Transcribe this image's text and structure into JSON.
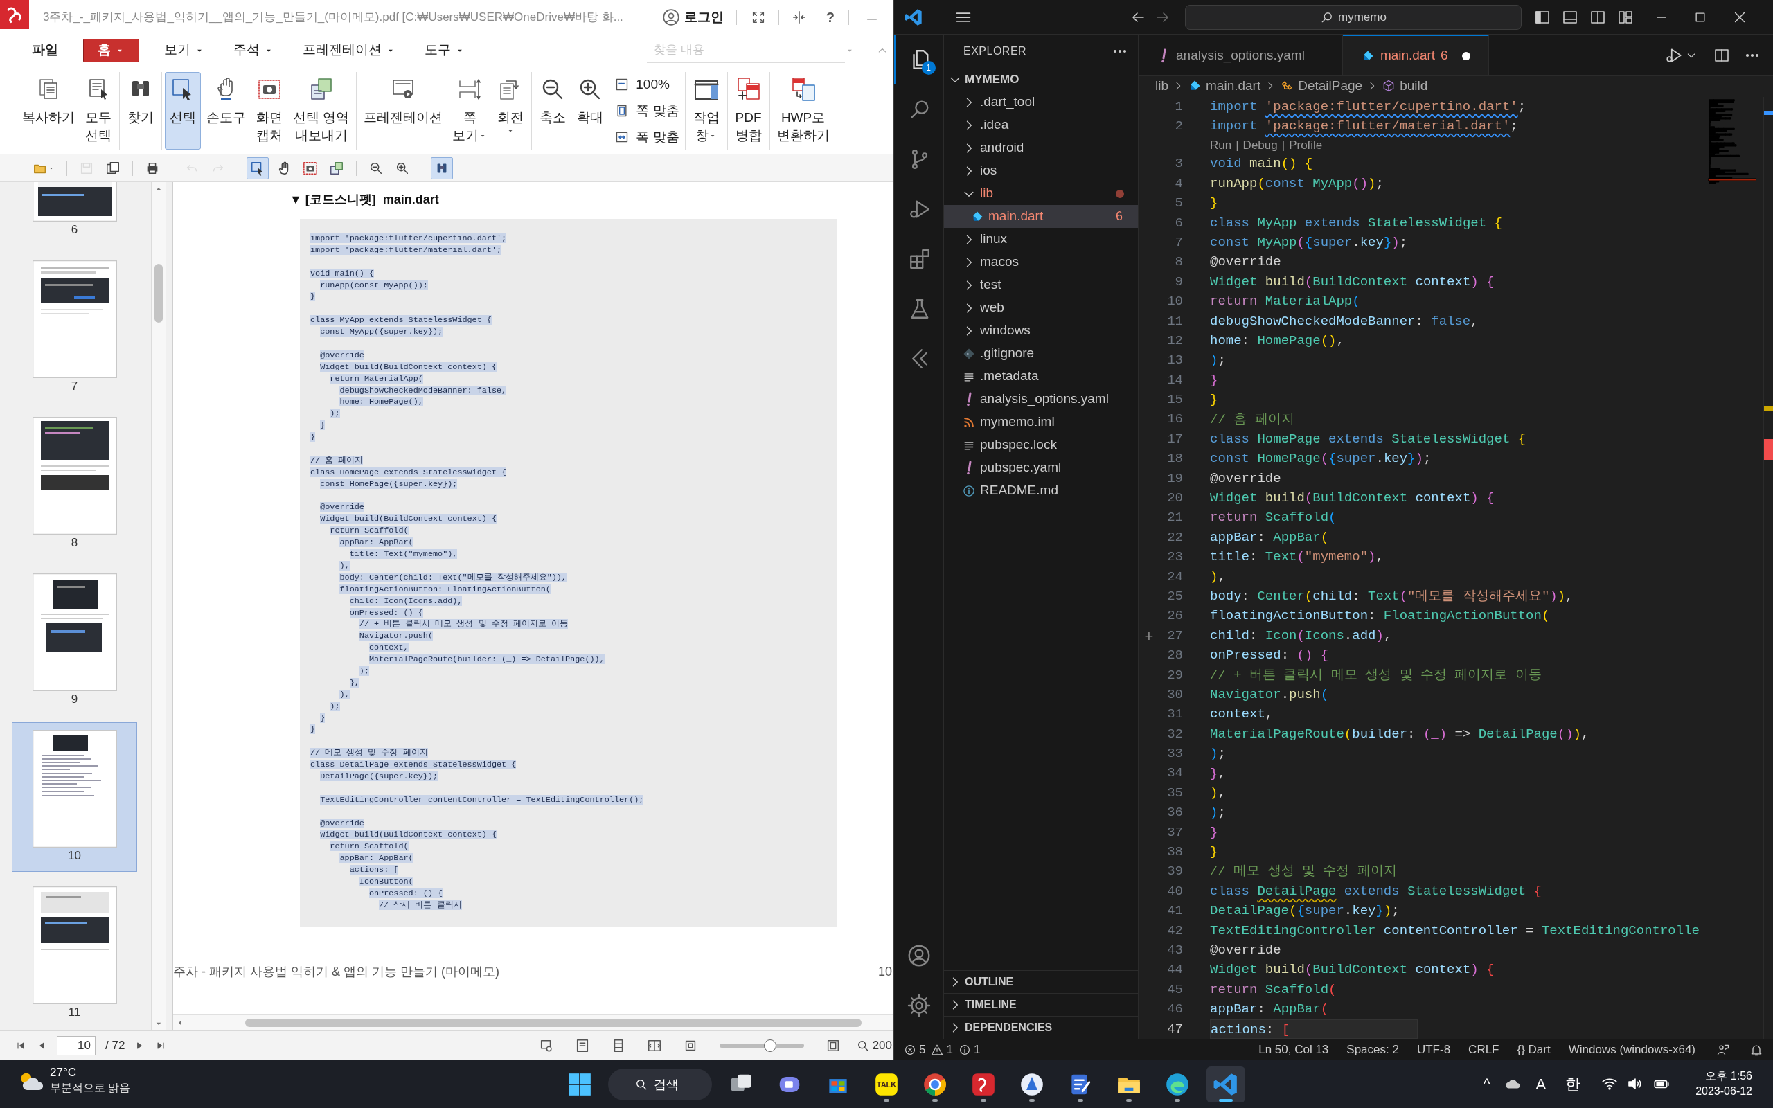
{
  "pdf_viewer": {
    "title": "3주차_-_패키지_사용법_익히기__앱의_기능_만들기_(마이메모).pdf [C:₩Users₩USER₩OneDrive₩바탕 화...",
    "login": "로그인",
    "help": "?",
    "menu": [
      {
        "label": "파일",
        "selected": false,
        "dropdown": false
      },
      {
        "label": "홈",
        "selected": true,
        "dropdown": true
      },
      {
        "label": "보기",
        "selected": false,
        "dropdown": true
      },
      {
        "label": "주석",
        "selected": false,
        "dropdown": true
      },
      {
        "label": "프레젠테이션",
        "selected": false,
        "dropdown": true
      },
      {
        "label": "도구",
        "selected": false,
        "dropdown": true
      }
    ],
    "search": {
      "placeholder": "찾을 내용"
    },
    "ribbon": [
      {
        "items": [
          {
            "label": "복사하기",
            "selected": false,
            "dropdown": false
          },
          {
            "label": "모두\n선택",
            "selected": false,
            "dropdown": false
          }
        ]
      },
      {
        "items": [
          {
            "label": "찾기",
            "selected": false,
            "dropdown": false
          }
        ]
      },
      {
        "items": [
          {
            "label": "선택",
            "selected": true,
            "dropdown": false
          },
          {
            "label": "손도구",
            "selected": false,
            "dropdown": false
          },
          {
            "label": "화면\n캡처",
            "selected": false,
            "dropdown": false
          },
          {
            "label": "선택 영역\n내보내기",
            "selected": false,
            "dropdown": false
          }
        ]
      },
      {
        "items": [
          {
            "label": "프레젠테이션",
            "selected": false,
            "dropdown": false
          },
          {
            "label": "쪽\n보기",
            "selected": false,
            "dropdown": true
          },
          {
            "label": "회전",
            "selected": false,
            "dropdown": true
          }
        ]
      },
      {
        "items": [
          {
            "label": "축소",
            "selected": false,
            "dropdown": false
          },
          {
            "label": "확대",
            "selected": false,
            "dropdown": false
          }
        ],
        "small": [
          "100%",
          "쪽 맞춤",
          "폭 맞춤"
        ]
      },
      {
        "items": [
          {
            "label": "작업\n창",
            "selected": false,
            "dropdown": true
          }
        ]
      },
      {
        "items": [
          {
            "label": "PDF\n병합",
            "selected": false,
            "dropdown": false
          }
        ]
      },
      {
        "items": [
          {
            "label": "HWP로\n변환하기",
            "selected": false,
            "dropdown": false
          }
        ]
      }
    ],
    "quick_toolbar": [
      {
        "selected": false,
        "disabled": false
      },
      {
        "selected": false,
        "disabled": true
      },
      {
        "selected": false,
        "disabled": false
      },
      {
        "selected": false,
        "disabled": false
      },
      {
        "selected": false,
        "disabled": true
      },
      {
        "selected": false,
        "disabled": true
      },
      {
        "selected": true,
        "disabled": false
      },
      {
        "selected": false,
        "disabled": false
      },
      {
        "selected": false,
        "disabled": false
      },
      {
        "selected": false,
        "disabled": false
      },
      {
        "selected": false,
        "disabled": false
      },
      {
        "selected": false,
        "disabled": false
      },
      {
        "selected": true,
        "disabled": false
      }
    ],
    "thumbnails": [
      {
        "page": "6",
        "selected": false
      },
      {
        "page": "7",
        "selected": false
      },
      {
        "page": "8",
        "selected": false
      },
      {
        "page": "9",
        "selected": false
      },
      {
        "page": "10",
        "selected": true
      },
      {
        "page": "11",
        "selected": false
      }
    ],
    "document": {
      "heading": "▼ [코드스니펫]  main.dart",
      "code_blocks": [
        [
          "import 'package:flutter/cupertino.dart';",
          "import 'package:flutter/material.dart';"
        ],
        [
          "void main() {",
          "  runApp(const MyApp());",
          "}"
        ],
        [
          "class MyApp extends StatelessWidget {",
          "  const MyApp({super.key});"
        ],
        [
          "  @override",
          "  Widget build(BuildContext context) {",
          "    return MaterialApp(",
          "      debugShowCheckedModeBanner: false,",
          "      home: HomePage(),",
          "    );",
          "  }",
          "}"
        ],
        [
          "// 홈 페이지",
          "class HomePage extends StatelessWidget {",
          "  const HomePage({super.key});"
        ],
        [
          "  @override",
          "  Widget build(BuildContext context) {",
          "    return Scaffold(",
          "      appBar: AppBar(",
          "        title: Text(\"mymemo\"),",
          "      ),",
          "      body: Center(child: Text(\"메모를 작성해주세요\")),",
          "      floatingActionButton: FloatingActionButton(",
          "        child: Icon(Icons.add),",
          "        onPressed: () {",
          "          // + 버튼 클릭시 메모 생성 및 수정 페이지로 이동",
          "          Navigator.push(",
          "            context,",
          "            MaterialPageRoute(builder: (_) => DetailPage()),",
          "          );",
          "        },",
          "      ),",
          "    );",
          "  }",
          "}"
        ],
        [
          "// 메모 생성 및 수정 페이지",
          "class DetailPage extends StatelessWidget {",
          "  DetailPage({super.key});"
        ],
        [
          "  TextEditingController contentController = TextEditingController();"
        ],
        [
          "  @override",
          "  Widget build(BuildContext context) {",
          "    return Scaffold(",
          "      appBar: AppBar(",
          "        actions: [",
          "          IconButton(",
          "            onPressed: () {",
          "              // 삭제 버튼 클릭시"
        ]
      ],
      "footer": "주차 - 패키지 사용법 익히기 & 앱의 기능 만들기 (마이메모)",
      "page_number": "10"
    },
    "status": {
      "page": "10",
      "total": "/ 72",
      "zoom_slider": {
        "level": 0.6
      },
      "zoom": "200"
    }
  },
  "vscode": {
    "command_center": "mymemo",
    "activity_bar": [
      {
        "selected": true,
        "badge": "1"
      },
      {
        "selected": false
      },
      {
        "selected": false
      },
      {
        "selected": false
      },
      {
        "selected": false
      },
      {
        "selected": false
      },
      {
        "selected": false
      }
    ],
    "explorer": {
      "title": "EXPLORER",
      "root": {
        "label": "MYMEMO",
        "expanded": true,
        "children": [
          {
            "label": ".dart_tool",
            "kind": "folder",
            "expanded": false,
            "selected": false,
            "error": false
          },
          {
            "label": ".idea",
            "kind": "folder",
            "expanded": false,
            "selected": false,
            "error": false
          },
          {
            "label": "android",
            "kind": "folder",
            "expanded": false,
            "selected": false,
            "error": false
          },
          {
            "label": "ios",
            "kind": "folder",
            "expanded": false,
            "selected": false,
            "error": false
          },
          {
            "label": "lib",
            "kind": "folder",
            "expanded": true,
            "selected": false,
            "error": true,
            "children": [
              {
                "label": "main.dart",
                "kind": "dart",
                "selected": true,
                "error": true,
                "problems": "6"
              }
            ]
          },
          {
            "label": "linux",
            "kind": "folder",
            "expanded": false,
            "selected": false,
            "error": false
          },
          {
            "label": "macos",
            "kind": "folder",
            "expanded": false,
            "selected": false,
            "error": false
          },
          {
            "label": "test",
            "kind": "folder",
            "expanded": false,
            "selected": false,
            "error": false
          },
          {
            "label": "web",
            "kind": "folder",
            "expanded": false,
            "selected": false,
            "error": false
          },
          {
            "label": "windows",
            "kind": "folder",
            "expanded": false,
            "selected": false,
            "error": false
          },
          {
            "label": ".gitignore",
            "kind": "git",
            "selected": false,
            "error": false
          },
          {
            "label": ".metadata",
            "kind": "text",
            "selected": false,
            "error": false
          },
          {
            "label": "analysis_options.yaml",
            "kind": "yaml",
            "selected": false,
            "error": false
          },
          {
            "label": "mymemo.iml",
            "kind": "feed",
            "selected": false,
            "error": false
          },
          {
            "label": "pubspec.lock",
            "kind": "text",
            "selected": false,
            "error": false
          },
          {
            "label": "pubspec.yaml",
            "kind": "yaml",
            "selected": false,
            "error": false
          },
          {
            "label": "README.md",
            "kind": "info",
            "selected": false,
            "error": false
          }
        ]
      }
    },
    "panels": [
      {
        "label": "OUTLINE",
        "expanded": false
      },
      {
        "label": "TIMELINE",
        "expanded": false
      },
      {
        "label": "DEPENDENCIES",
        "expanded": false
      }
    ],
    "tabs": [
      {
        "label": "analysis_options.yaml",
        "kind": "yaml",
        "selected": false,
        "error": false,
        "modified": false
      },
      {
        "label": "main.dart",
        "kind": "dart",
        "selected": true,
        "error": true,
        "problems": "6",
        "modified": true
      }
    ],
    "breadcrumb": [
      {
        "label": "lib",
        "kind": "folder"
      },
      {
        "label": "main.dart",
        "kind": "dart"
      },
      {
        "label": "DetailPage",
        "kind": "class"
      },
      {
        "label": "build",
        "kind": "method"
      }
    ],
    "lines": [
      {
        "kind": "code",
        "n": "1",
        "current": false,
        "code": [
          {
            "kind": "kw",
            "text": "import "
          },
          {
            "kind": "str_info",
            "text": "'package:flutter/cupertino.dart'"
          },
          {
            "kind": "txt",
            "text": ";"
          }
        ]
      },
      {
        "kind": "code",
        "n": "2",
        "current": false,
        "code": [
          {
            "kind": "kw",
            "text": "import "
          },
          {
            "kind": "str_info",
            "text": "'package:flutter/material.dart'"
          },
          {
            "kind": "txt",
            "text": ";"
          }
        ]
      },
      {
        "kind": "codelens",
        "links": [
          "Run",
          "Debug",
          "Profile"
        ],
        "separator": "|"
      },
      {
        "kind": "code",
        "n": "3",
        "current": false,
        "code": [
          {
            "kind": "kw",
            "text": "void "
          },
          {
            "kind": "fn",
            "text": "main"
          },
          {
            "kind": "br1",
            "text": "() {"
          }
        ]
      },
      {
        "kind": "code",
        "n": "4",
        "current": false,
        "code": [
          {
            "kind": "fn",
            "text": "runApp"
          },
          {
            "kind": "br1",
            "text": "("
          },
          {
            "kind": "kw",
            "text": "const "
          },
          {
            "kind": "type",
            "text": "MyApp"
          },
          {
            "kind": "br2",
            "text": "()"
          },
          {
            "kind": "br1",
            "text": ")"
          },
          {
            "kind": "txt",
            "text": ";"
          }
        ]
      },
      {
        "kind": "code",
        "n": "5",
        "current": false,
        "code": [
          {
            "kind": "br1",
            "text": "}"
          }
        ]
      },
      {
        "kind": "code",
        "n": "6",
        "current": false,
        "code": [
          {
            "kind": "kw",
            "text": "class "
          },
          {
            "kind": "type",
            "text": "MyApp "
          },
          {
            "kind": "kw",
            "text": "extends "
          },
          {
            "kind": "type",
            "text": "StatelessWidget "
          },
          {
            "kind": "br1",
            "text": "{"
          }
        ]
      },
      {
        "kind": "code",
        "n": "7",
        "current": false,
        "code": [
          {
            "kind": "kw",
            "text": "const "
          },
          {
            "kind": "type",
            "text": "MyApp"
          },
          {
            "kind": "br2",
            "text": "("
          },
          {
            "kind": "br3",
            "text": "{"
          },
          {
            "kind": "kw",
            "text": "super"
          },
          {
            "kind": "txt",
            "text": "."
          },
          {
            "kind": "var",
            "text": "key"
          },
          {
            "kind": "br3",
            "text": "}"
          },
          {
            "kind": "br2",
            "text": ")"
          },
          {
            "kind": "txt",
            "text": ";"
          }
        ]
      },
      {
        "kind": "code",
        "n": "8",
        "current": false,
        "code": [
          {
            "kind": "txt",
            "text": "@override"
          }
        ]
      },
      {
        "kind": "code",
        "n": "9",
        "current": false,
        "code": [
          {
            "kind": "type",
            "text": "Widget "
          },
          {
            "kind": "fn",
            "text": "build"
          },
          {
            "kind": "br2",
            "text": "("
          },
          {
            "kind": "type",
            "text": "BuildContext "
          },
          {
            "kind": "var",
            "text": "context"
          },
          {
            "kind": "br2",
            "text": ") {"
          }
        ]
      },
      {
        "kind": "code",
        "n": "10",
        "current": false,
        "code": [
          {
            "kind": "ctl",
            "text": "return "
          },
          {
            "kind": "type",
            "text": "MaterialApp"
          },
          {
            "kind": "br3",
            "text": "("
          }
        ]
      },
      {
        "kind": "code",
        "n": "11",
        "current": false,
        "code": [
          {
            "kind": "var",
            "text": "debugShowCheckedModeBanner"
          },
          {
            "kind": "txt",
            "text": ": "
          },
          {
            "kind": "kw",
            "text": "false"
          },
          {
            "kind": "txt",
            "text": ","
          }
        ]
      },
      {
        "kind": "code",
        "n": "12",
        "current": false,
        "code": [
          {
            "kind": "var",
            "text": "home"
          },
          {
            "kind": "txt",
            "text": ": "
          },
          {
            "kind": "type",
            "text": "HomePage"
          },
          {
            "kind": "br1",
            "text": "()"
          },
          {
            "kind": "txt",
            "text": ","
          }
        ]
      },
      {
        "kind": "code",
        "n": "13",
        "current": false,
        "code": [
          {
            "kind": "br3",
            "text": ")"
          },
          {
            "kind": "txt",
            "text": ";"
          }
        ]
      },
      {
        "kind": "code",
        "n": "14",
        "current": false,
        "code": [
          {
            "kind": "br2",
            "text": "}"
          }
        ]
      },
      {
        "kind": "code",
        "n": "15",
        "current": false,
        "code": [
          {
            "kind": "br1",
            "text": "}"
          }
        ]
      },
      {
        "kind": "code",
        "n": "16",
        "current": false,
        "code": [
          {
            "kind": "cmt",
            "text": "// 홈 페이지"
          }
        ]
      },
      {
        "kind": "code",
        "n": "17",
        "current": false,
        "code": [
          {
            "kind": "kw",
            "text": "class "
          },
          {
            "kind": "type",
            "text": "HomePage "
          },
          {
            "kind": "kw",
            "text": "extends "
          },
          {
            "kind": "type",
            "text": "StatelessWidget "
          },
          {
            "kind": "br1",
            "text": "{"
          }
        ]
      },
      {
        "kind": "code",
        "n": "18",
        "current": false,
        "code": [
          {
            "kind": "kw",
            "text": "const "
          },
          {
            "kind": "type",
            "text": "HomePage"
          },
          {
            "kind": "br2",
            "text": "("
          },
          {
            "kind": "br3",
            "text": "{"
          },
          {
            "kind": "kw",
            "text": "super"
          },
          {
            "kind": "txt",
            "text": "."
          },
          {
            "kind": "var",
            "text": "key"
          },
          {
            "kind": "br3",
            "text": "}"
          },
          {
            "kind": "br2",
            "text": ")"
          },
          {
            "kind": "txt",
            "text": ";"
          }
        ]
      },
      {
        "kind": "code",
        "n": "19",
        "current": false,
        "code": [
          {
            "kind": "txt",
            "text": "@override"
          }
        ]
      },
      {
        "kind": "code",
        "n": "20",
        "current": false,
        "code": [
          {
            "kind": "type",
            "text": "Widget "
          },
          {
            "kind": "fn",
            "text": "build"
          },
          {
            "kind": "br2",
            "text": "("
          },
          {
            "kind": "type",
            "text": "BuildContext "
          },
          {
            "kind": "var",
            "text": "context"
          },
          {
            "kind": "br2",
            "text": ") {"
          }
        ]
      },
      {
        "kind": "code",
        "n": "21",
        "current": false,
        "code": [
          {
            "kind": "ctl",
            "text": "return "
          },
          {
            "kind": "type",
            "text": "Scaffold"
          },
          {
            "kind": "br3",
            "text": "("
          }
        ]
      },
      {
        "kind": "code",
        "n": "22",
        "current": false,
        "code": [
          {
            "kind": "var",
            "text": "appBar"
          },
          {
            "kind": "txt",
            "text": ": "
          },
          {
            "kind": "type",
            "text": "AppBar"
          },
          {
            "kind": "br1",
            "text": "("
          }
        ]
      },
      {
        "kind": "code",
        "n": "23",
        "current": false,
        "code": [
          {
            "kind": "var",
            "text": "title"
          },
          {
            "kind": "txt",
            "text": ": "
          },
          {
            "kind": "type",
            "text": "Text"
          },
          {
            "kind": "br2",
            "text": "("
          },
          {
            "kind": "str",
            "text": "\"mymemo\""
          },
          {
            "kind": "br2",
            "text": ")"
          },
          {
            "kind": "txt",
            "text": ","
          }
        ]
      },
      {
        "kind": "code",
        "n": "24",
        "current": false,
        "code": [
          {
            "kind": "br1",
            "text": ")"
          },
          {
            "kind": "txt",
            "text": ","
          }
        ]
      },
      {
        "kind": "code",
        "n": "25",
        "current": false,
        "code": [
          {
            "kind": "var",
            "text": "body"
          },
          {
            "kind": "txt",
            "text": ": "
          },
          {
            "kind": "type",
            "text": "Center"
          },
          {
            "kind": "br1",
            "text": "("
          },
          {
            "kind": "var",
            "text": "child"
          },
          {
            "kind": "txt",
            "text": ": "
          },
          {
            "kind": "type",
            "text": "Text"
          },
          {
            "kind": "br2",
            "text": "("
          },
          {
            "kind": "str",
            "text": "\"메모를 작성해주세요\""
          },
          {
            "kind": "br2",
            "text": ")"
          },
          {
            "kind": "br1",
            "text": ")"
          },
          {
            "kind": "txt",
            "text": ","
          }
        ]
      },
      {
        "kind": "code",
        "n": "26",
        "current": false,
        "code": [
          {
            "kind": "var",
            "text": "floatingActionButton"
          },
          {
            "kind": "txt",
            "text": ": "
          },
          {
            "kind": "type",
            "text": "FloatingActionButton"
          },
          {
            "kind": "br1",
            "text": "("
          }
        ]
      },
      {
        "kind": "code",
        "n": "27",
        "current": false,
        "gutter": "+",
        "code": [
          {
            "kind": "var",
            "text": "child"
          },
          {
            "kind": "txt",
            "text": ": "
          },
          {
            "kind": "type",
            "text": "Icon"
          },
          {
            "kind": "br2",
            "text": "("
          },
          {
            "kind": "type",
            "text": "Icons"
          },
          {
            "kind": "txt",
            "text": "."
          },
          {
            "kind": "var",
            "text": "add"
          },
          {
            "kind": "br2",
            "text": ")"
          },
          {
            "kind": "txt",
            "text": ","
          }
        ]
      },
      {
        "kind": "code",
        "n": "28",
        "current": false,
        "code": [
          {
            "kind": "var",
            "text": "onPressed"
          },
          {
            "kind": "txt",
            "text": ": "
          },
          {
            "kind": "br2",
            "text": "() {"
          }
        ]
      },
      {
        "kind": "code",
        "n": "29",
        "current": false,
        "code": [
          {
            "kind": "cmt",
            "text": "// + 버튼 클릭시 메모 생성 및 수정 페이지로 이동"
          }
        ]
      },
      {
        "kind": "code",
        "n": "30",
        "current": false,
        "code": [
          {
            "kind": "type",
            "text": "Navigator"
          },
          {
            "kind": "txt",
            "text": "."
          },
          {
            "kind": "fn",
            "text": "push"
          },
          {
            "kind": "br3",
            "text": "("
          }
        ]
      },
      {
        "kind": "code",
        "n": "31",
        "current": false,
        "code": [
          {
            "kind": "var",
            "text": "context"
          },
          {
            "kind": "txt",
            "text": ","
          }
        ]
      },
      {
        "kind": "code",
        "n": "32",
        "current": false,
        "code": [
          {
            "kind": "type",
            "text": "MaterialPageRoute"
          },
          {
            "kind": "br1",
            "text": "("
          },
          {
            "kind": "var",
            "text": "builder"
          },
          {
            "kind": "txt",
            "text": ": "
          },
          {
            "kind": "br2",
            "text": "(_)"
          },
          {
            "kind": "txt",
            "text": " => "
          },
          {
            "kind": "type",
            "text": "DetailPage"
          },
          {
            "kind": "br2",
            "text": "()"
          },
          {
            "kind": "br1",
            "text": ")"
          },
          {
            "kind": "txt",
            "text": ","
          }
        ]
      },
      {
        "kind": "code",
        "n": "33",
        "current": false,
        "code": [
          {
            "kind": "br3",
            "text": ")"
          },
          {
            "kind": "txt",
            "text": ";"
          }
        ]
      },
      {
        "kind": "code",
        "n": "34",
        "current": false,
        "code": [
          {
            "kind": "br2",
            "text": "}"
          },
          {
            "kind": "txt",
            "text": ","
          }
        ]
      },
      {
        "kind": "code",
        "n": "35",
        "current": false,
        "code": [
          {
            "kind": "br1",
            "text": ")"
          },
          {
            "kind": "txt",
            "text": ","
          }
        ]
      },
      {
        "kind": "code",
        "n": "36",
        "current": false,
        "code": [
          {
            "kind": "br3",
            "text": ")"
          },
          {
            "kind": "txt",
            "text": ";"
          }
        ]
      },
      {
        "kind": "code",
        "n": "37",
        "current": false,
        "code": [
          {
            "kind": "br2",
            "text": "}"
          }
        ]
      },
      {
        "kind": "code",
        "n": "38",
        "current": false,
        "code": [
          {
            "kind": "br1",
            "text": "}"
          }
        ]
      },
      {
        "kind": "code",
        "n": "39",
        "current": false,
        "code": [
          {
            "kind": "cmt",
            "text": "// 메모 생성 및 수정 페이지"
          }
        ]
      },
      {
        "kind": "code",
        "n": "40",
        "current": false,
        "code": [
          {
            "kind": "kw",
            "text": "class "
          },
          {
            "kind": "type_warn",
            "text": "DetailPage"
          },
          {
            "kind": "kw",
            "text": " extends "
          },
          {
            "kind": "type",
            "text": "StatelessWidget "
          },
          {
            "kind": "bad",
            "text": "{"
          }
        ]
      },
      {
        "kind": "code",
        "n": "41",
        "current": false,
        "code": [
          {
            "kind": "type",
            "text": "DetailPage"
          },
          {
            "kind": "br1",
            "text": "("
          },
          {
            "kind": "br3",
            "text": "{"
          },
          {
            "kind": "kw",
            "text": "super"
          },
          {
            "kind": "txt",
            "text": "."
          },
          {
            "kind": "var",
            "text": "key"
          },
          {
            "kind": "br3",
            "text": "}"
          },
          {
            "kind": "br1",
            "text": ")"
          },
          {
            "kind": "txt",
            "text": ";"
          }
        ]
      },
      {
        "kind": "code",
        "n": "42",
        "current": false,
        "code": [
          {
            "kind": "type",
            "text": "TextEditingController "
          },
          {
            "kind": "var",
            "text": "contentController"
          },
          {
            "kind": "txt",
            "text": " = "
          },
          {
            "kind": "type",
            "text": "TextEditingControlle"
          }
        ]
      },
      {
        "kind": "code",
        "n": "43",
        "current": false,
        "code": [
          {
            "kind": "txt",
            "text": "@override"
          }
        ]
      },
      {
        "kind": "code",
        "n": "44",
        "current": false,
        "code": [
          {
            "kind": "type",
            "text": "Widget "
          },
          {
            "kind": "fn",
            "text": "build"
          },
          {
            "kind": "br2",
            "text": "("
          },
          {
            "kind": "type",
            "text": "BuildContext "
          },
          {
            "kind": "var",
            "text": "context"
          },
          {
            "kind": "br2",
            "text": ")"
          },
          {
            "kind": "bad",
            "text": " {"
          }
        ]
      },
      {
        "kind": "code",
        "n": "45",
        "current": false,
        "code": [
          {
            "kind": "ctl",
            "text": "return "
          },
          {
            "kind": "type",
            "text": "Scaffold"
          },
          {
            "kind": "bad",
            "text": "("
          }
        ]
      },
      {
        "kind": "code",
        "n": "46",
        "current": false,
        "code": [
          {
            "kind": "var",
            "text": "appBar"
          },
          {
            "kind": "txt",
            "text": ": "
          },
          {
            "kind": "type",
            "text": "AppBar"
          },
          {
            "kind": "bad",
            "text": "("
          }
        ]
      },
      {
        "kind": "code",
        "n": "47",
        "current": true,
        "code": [
          {
            "kind": "var",
            "text": "actions"
          },
          {
            "kind": "txt",
            "text": ": "
          },
          {
            "kind": "bad",
            "text": "["
          }
        ]
      }
    ],
    "status_bar": {
      "errors": "5",
      "warnings": "1",
      "infos": "1",
      "items": [
        "Ln 50, Col 13",
        "Spaces: 2",
        "UTF-8",
        "CRLF",
        "{} Dart",
        "Windows (windows-x64)"
      ]
    }
  },
  "taskbar": {
    "weather": {
      "temp": "27°C",
      "desc": "부분적으로 맑음"
    },
    "search": "검색",
    "apps": [
      {
        "kind": "taskview",
        "running": false,
        "selected": false
      },
      {
        "kind": "chat",
        "running": false,
        "selected": false
      },
      {
        "kind": "store",
        "running": false,
        "selected": false
      },
      {
        "kind": "kakao",
        "text": "TALK",
        "running": true,
        "selected": false
      },
      {
        "kind": "chrome",
        "running": true,
        "selected": false
      },
      {
        "kind": "pdf",
        "running": true,
        "selected": false
      },
      {
        "kind": "assistant",
        "running": true,
        "selected": false
      },
      {
        "kind": "notes",
        "running": true,
        "selected": false
      },
      {
        "kind": "folder",
        "running": true,
        "selected": false
      },
      {
        "kind": "edge",
        "running": true,
        "selected": false
      },
      {
        "kind": "vscode",
        "running": true,
        "selected": true
      }
    ],
    "tray": {
      "overflow": "^",
      "ime_mode": "A",
      "ime_lang": "한",
      "time": "오후 1:56",
      "date": "2023-06-12"
    }
  }
}
